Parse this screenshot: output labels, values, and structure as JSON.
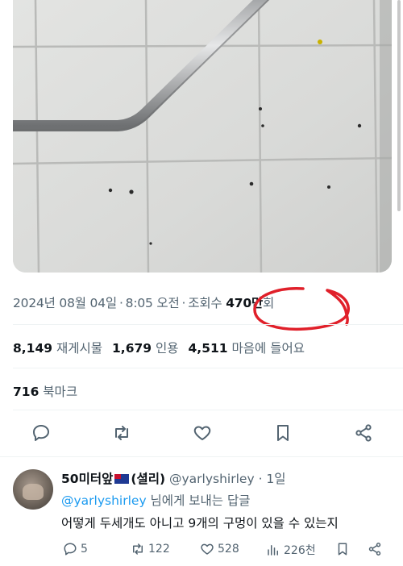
{
  "tweet": {
    "date": "2024년 08월 04일",
    "time": "8:05 오전",
    "views_label_prefix": "조회",
    "views_label_suffix": "수",
    "views_count": "470만",
    "views_unit": "회"
  },
  "stats": {
    "retweets_count": "8,149",
    "retweets_label": "재게시물",
    "quotes_count": "1,679",
    "quotes_label": "인용",
    "likes_count": "4,511",
    "likes_label": "마음에 들어요",
    "bookmarks_count": "716",
    "bookmarks_label": "북마크"
  },
  "actions": [
    "reply-icon",
    "retweet-icon",
    "like-icon",
    "bookmark-icon",
    "share-icon"
  ],
  "reply": {
    "name_prefix": "50미터앞",
    "name_suffix": "(셜리)",
    "handle": "@yarlyshirley",
    "age": "· 1일",
    "replying_to_mention": "@yarlyshirley",
    "replying_to_suffix": " 님에게 보내는 답글",
    "text": "어떻게 두세개도 아니고 9개의 구멍이 있을 수 있는지",
    "replies": "5",
    "retweets": "122",
    "likes": "528",
    "views": "226천"
  },
  "colors": {
    "text": "#0f1419",
    "secondary": "#536471",
    "link": "#1d9bf0",
    "annotation": "#e0202a"
  }
}
